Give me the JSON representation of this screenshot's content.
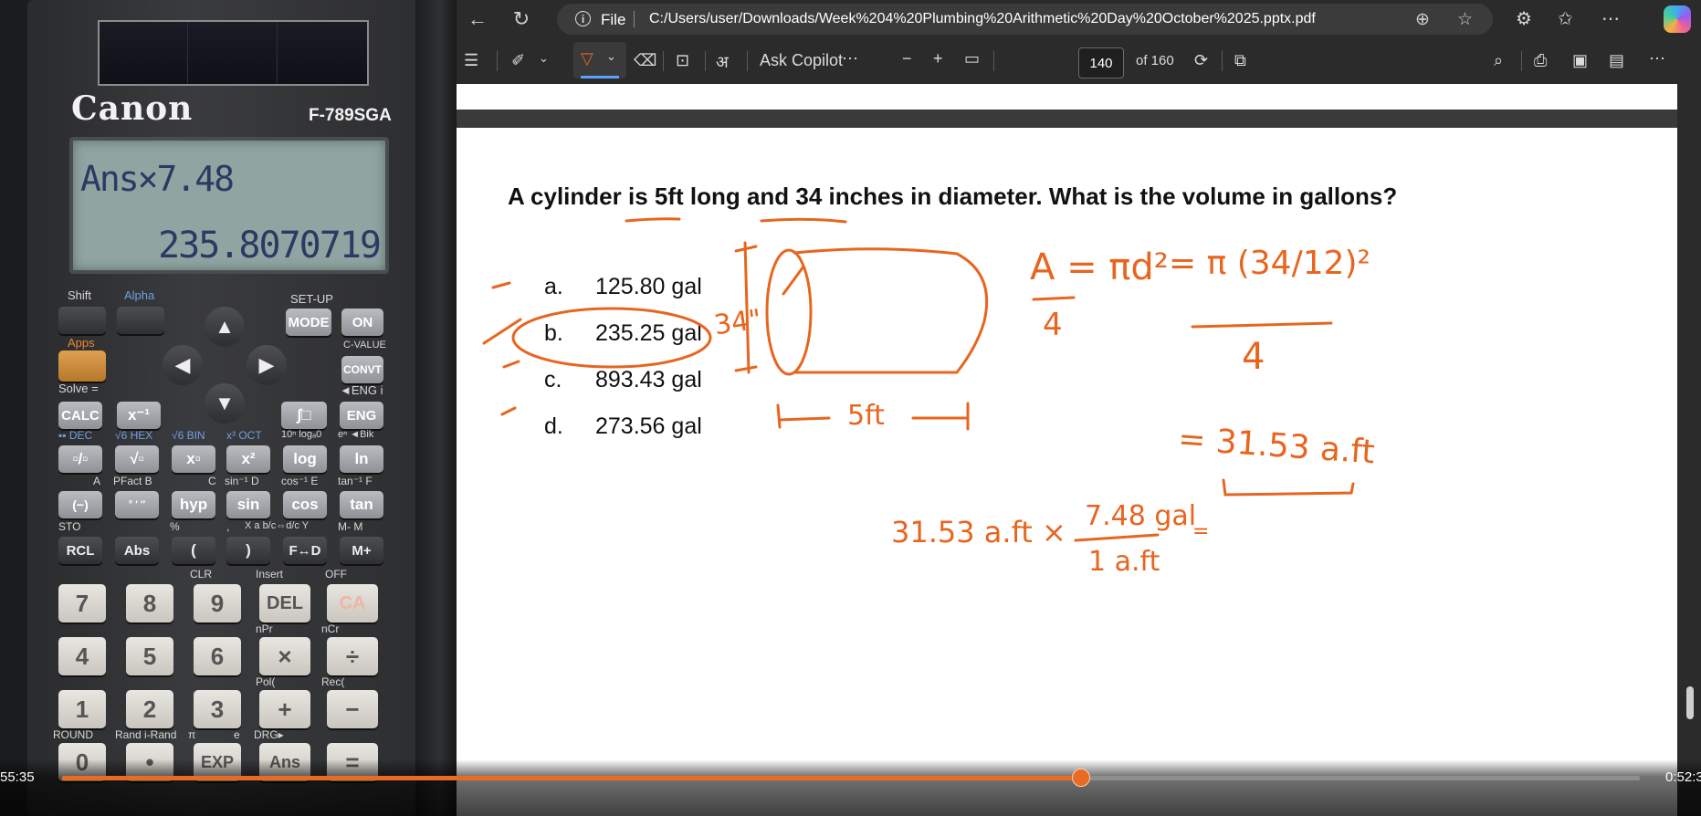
{
  "calculator": {
    "brand": "Canon",
    "model": "F-789SGA",
    "display_expression": "Ans×7.48",
    "display_result": "235.8070719",
    "top_labels": {
      "shift": "Shift",
      "alpha": "Alpha",
      "setup": "SET-UP",
      "apps": "Apps",
      "cvalue": "C-VALUE",
      "solve": "Solve =",
      "engi": "◄ENG i",
      "dec": "▪▪ DEC",
      "hex": "√6 HEX",
      "bin": "√6 BIN",
      "oct": "x³ OCT",
      "ten": "10ⁿ logₐ0",
      "ebik": "eⁿ ◄Bik",
      "a": "A",
      "pfact": "PFact B",
      "c": "C",
      "sinm1": "sin⁻¹ D",
      "cosm1": "cos⁻¹ E",
      "tanm1": "tan⁻¹ F",
      "sto": "STO",
      "pct": "%",
      "comma": ",",
      "xabc": "X a b/c⇔d/c Y",
      "mminus": "M- M",
      "clr": "CLR",
      "insert": "Insert",
      "off": "OFF",
      "npr": "nPr",
      "ncr": "nCr",
      "pol": "Pol(",
      "rec": "Rec(",
      "round": "ROUND",
      "rand": "Rand i-Rand",
      "pi": "π",
      "e": "e",
      "drg": "DRG▸"
    },
    "keys": {
      "mode": "MODE",
      "on": "ON",
      "convt": "CONVT",
      "calc": "CALC",
      "xm1": "x⁻¹",
      "intg": "∫□",
      "eng": "ENG",
      "frac": "▫/▫",
      "sqrt": "√▫",
      "xsq": "x²",
      "xpow": "x▫",
      "log": "log",
      "ln": "ln",
      "neg": "(−)",
      "dms": "° ′ ″",
      "hyp": "hyp",
      "sin": "sin",
      "cos": "cos",
      "tan": "tan",
      "rcl": "RCL",
      "abs": "Abs",
      "lpar": "(",
      "rpar": ")",
      "fd": "F↔D",
      "mplus": "M+",
      "n7": "7",
      "n8": "8",
      "n9": "9",
      "del": "DEL",
      "ca": "CA",
      "n4": "4",
      "n5": "5",
      "n6": "6",
      "times": "×",
      "divide": "÷",
      "n1": "1",
      "n2": "2",
      "n3": "3",
      "plus": "+",
      "minus": "−",
      "n0": "0",
      "dot": "•",
      "exp": "EXP",
      "ans": "Ans",
      "equals": "="
    }
  },
  "browser": {
    "file_label": "File",
    "url": "C:/Users/user/Downloads/Week%204%20Plumbing%20Arithmetic%20Day%20October%2025.pptx.pdf",
    "ask_copilot": "Ask Copilot",
    "page_number": "140",
    "page_total": "of 160"
  },
  "slide": {
    "question": "A cylinder is 5ft long and 34 inches in diameter. What is the volume in gallons?",
    "options": [
      {
        "letter": "a.",
        "text": "125.80 gal"
      },
      {
        "letter": "b.",
        "text": "235.25 gal"
      },
      {
        "letter": "c.",
        "text": "893.43 gal"
      },
      {
        "letter": "d.",
        "text": "273.56 gal"
      }
    ],
    "ink_notes": {
      "diameter": "34\"",
      "length": "5ft",
      "area_formula": "A = πd²",
      "area_den": "4",
      "area_sub": "= π (34/12)²",
      "area_sub_den": "4",
      "area_result": "= 31.53 a.ft",
      "conversion_left": "31.53 a.ft ×",
      "conversion_num": "7.48 gal",
      "conversion_den": "1 a.ft",
      "conversion_eq": "="
    },
    "ink_color": "#e8651f"
  },
  "video": {
    "elapsed": "55:35",
    "duration": "0:52:3",
    "progress": 0.646,
    "accent": "#e96a22"
  }
}
